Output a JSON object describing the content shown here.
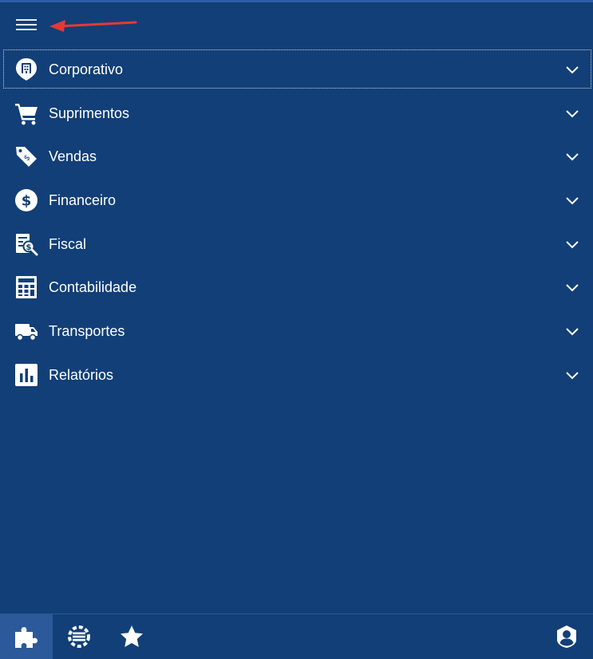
{
  "header": {
    "menu_icon": "hamburger-icon",
    "annotation_icon": "red-arrow-left"
  },
  "menu": {
    "items": [
      {
        "label": "Corporativo",
        "icon": "building-pin-icon",
        "focused": true
      },
      {
        "label": "Suprimentos",
        "icon": "shopping-cart-icon"
      },
      {
        "label": "Vendas",
        "icon": "price-tag-icon"
      },
      {
        "label": "Financeiro",
        "icon": "dollar-coin-icon"
      },
      {
        "label": "Fiscal",
        "icon": "tax-document-search-icon"
      },
      {
        "label": "Contabilidade",
        "icon": "calculator-icon"
      },
      {
        "label": "Transportes",
        "icon": "truck-icon"
      },
      {
        "label": "Relatórios",
        "icon": "bar-chart-icon"
      }
    ]
  },
  "bottom_bar": {
    "buttons": [
      {
        "icon": "puzzle-icon",
        "active": true
      },
      {
        "icon": "settings-sliders-icon"
      },
      {
        "icon": "star-icon"
      },
      {
        "icon": "user-profile-icon"
      }
    ]
  },
  "colors": {
    "background": "#123F77",
    "active_tab": "#2B5999",
    "annotation": "#E53935",
    "text": "#FFFFFF"
  }
}
